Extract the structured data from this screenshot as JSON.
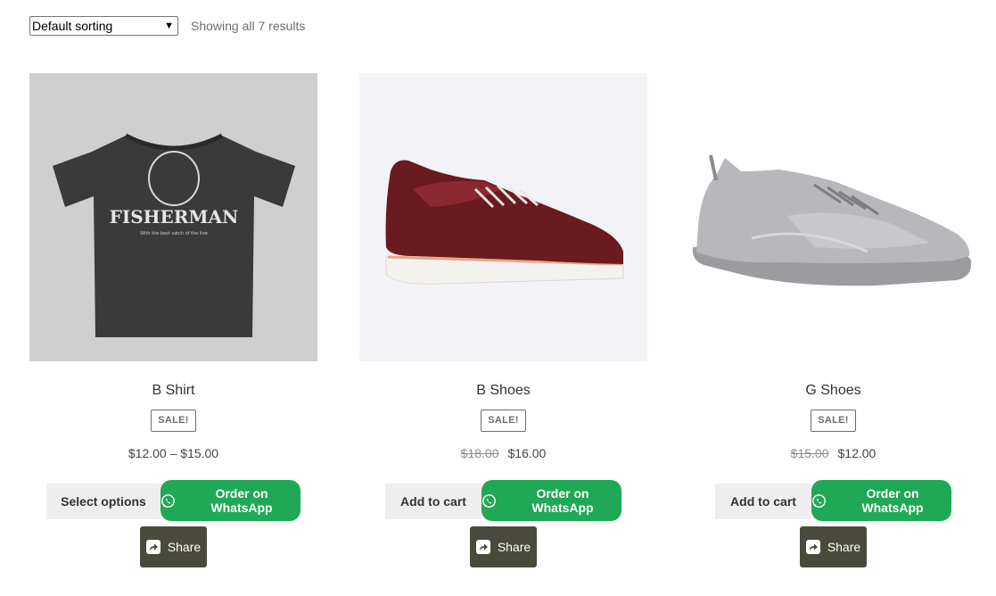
{
  "toolbar": {
    "sort_value": "Default sorting",
    "result_count": "Showing all 7 results"
  },
  "products": [
    {
      "title": "B Shirt",
      "sale_badge": "SALE!",
      "price_old": "",
      "price_current": "$12.00 – $15.00",
      "cart_button": "Select options",
      "whatsapp_button": "Order on WhatsApp",
      "share_button": "Share",
      "image_text": "FISHERMAN",
      "image_subtext": "With the best catch of the line"
    },
    {
      "title": "B Shoes",
      "sale_badge": "SALE!",
      "price_old": "$18.00",
      "price_current": "$16.00",
      "cart_button": "Add to cart",
      "whatsapp_button": "Order on WhatsApp",
      "share_button": "Share"
    },
    {
      "title": "G Shoes",
      "sale_badge": "SALE!",
      "price_old": "$15.00",
      "price_current": "$12.00",
      "cart_button": "Add to cart",
      "whatsapp_button": "Order on WhatsApp",
      "share_button": "Share"
    }
  ],
  "icons": {
    "whatsapp": "whatsapp-icon",
    "share": "share-icon",
    "sort_chevron": "chevron-down-icon"
  },
  "colors": {
    "whatsapp_green": "#1fa855",
    "share_dark": "#4a4a3c",
    "cart_bg": "#eeeeee"
  }
}
